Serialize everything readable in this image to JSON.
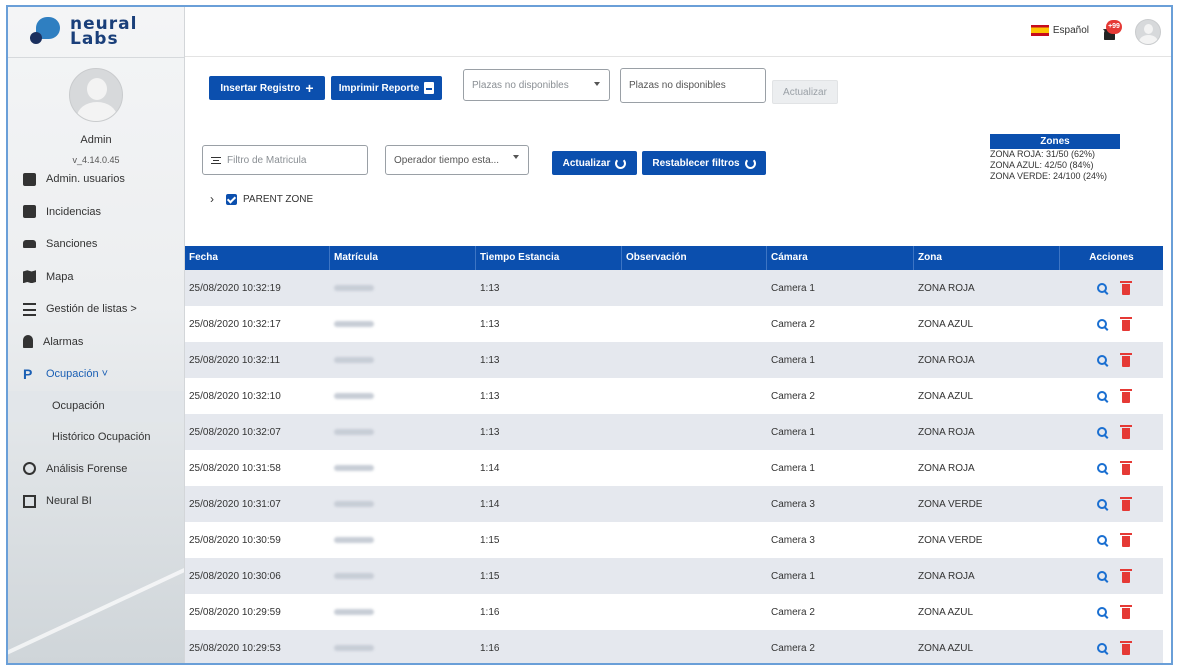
{
  "brand": {
    "line1": "neural",
    "line2": "Labs"
  },
  "user": {
    "name": "Admin",
    "version": "v_4.14.0.45"
  },
  "nav": {
    "items": [
      {
        "label": "Admin. usuarios",
        "icon": "user-badge-icon"
      },
      {
        "label": "Incidencias",
        "icon": "list-box-icon"
      },
      {
        "label": "Sanciones",
        "icon": "car-icon"
      },
      {
        "label": "Mapa",
        "icon": "map-icon"
      },
      {
        "label": "Gestión de listas >",
        "icon": "list-icon"
      },
      {
        "label": "Alarmas",
        "icon": "bell-icon"
      },
      {
        "label": "Ocupación ˅",
        "icon": "parking-icon"
      }
    ],
    "sub_items": [
      {
        "label": "Ocupación"
      },
      {
        "label": "Histórico Ocupación"
      }
    ],
    "after": [
      {
        "label": "Análisis Forense",
        "icon": "fingerprint-icon"
      },
      {
        "label": "Neural BI",
        "icon": "chart-grid-icon"
      }
    ]
  },
  "header": {
    "language": "Español",
    "notifications_badge": "+99"
  },
  "toolbar": {
    "insert_label": "Insertar Registro",
    "print_label": "Imprimir Reporte",
    "plazas_select_placeholder": "Plazas no disponibles",
    "plazas_input_placeholder": "Plazas no disponibles",
    "update_disabled_label": "Actualizar"
  },
  "filters": {
    "matricula_placeholder": "Filtro de Matricula",
    "operator_placeholder": "Operador tiempo esta...",
    "update_label": "Actualizar",
    "reset_label": "Restablecer filtros"
  },
  "zones": {
    "title": "Zones",
    "lines": [
      "ZONA ROJA: 31/50 (62%)",
      "ZONA AZUL: 42/50 (84%)",
      "ZONA VERDE: 24/100 (24%)"
    ]
  },
  "tree": {
    "label": "PARENT ZONE"
  },
  "table": {
    "columns": [
      "Fecha",
      "Matrícula",
      "Tiempo Estancia",
      "Observación",
      "Cámara",
      "Zona",
      "Acciones"
    ],
    "rows": [
      {
        "fecha": "25/08/2020 10:32:19",
        "tiempo": "1:13",
        "obs": "",
        "camara": "Camera 1",
        "zona": "ZONA ROJA"
      },
      {
        "fecha": "25/08/2020 10:32:17",
        "tiempo": "1:13",
        "obs": "",
        "camara": "Camera 2",
        "zona": "ZONA AZUL"
      },
      {
        "fecha": "25/08/2020 10:32:11",
        "tiempo": "1:13",
        "obs": "",
        "camara": "Camera 1",
        "zona": "ZONA ROJA"
      },
      {
        "fecha": "25/08/2020 10:32:10",
        "tiempo": "1:13",
        "obs": "",
        "camara": "Camera 2",
        "zona": "ZONA AZUL"
      },
      {
        "fecha": "25/08/2020 10:32:07",
        "tiempo": "1:13",
        "obs": "",
        "camara": "Camera 1",
        "zona": "ZONA ROJA"
      },
      {
        "fecha": "25/08/2020 10:31:58",
        "tiempo": "1:14",
        "obs": "",
        "camara": "Camera 1",
        "zona": "ZONA ROJA"
      },
      {
        "fecha": "25/08/2020 10:31:07",
        "tiempo": "1:14",
        "obs": "",
        "camara": "Camera 3",
        "zona": "ZONA VERDE"
      },
      {
        "fecha": "25/08/2020 10:30:59",
        "tiempo": "1:15",
        "obs": "",
        "camara": "Camera 3",
        "zona": "ZONA VERDE"
      },
      {
        "fecha": "25/08/2020 10:30:06",
        "tiempo": "1:15",
        "obs": "",
        "camara": "Camera 1",
        "zona": "ZONA ROJA"
      },
      {
        "fecha": "25/08/2020 10:29:59",
        "tiempo": "1:16",
        "obs": "",
        "camara": "Camera 2",
        "zona": "ZONA AZUL"
      },
      {
        "fecha": "25/08/2020 10:29:53",
        "tiempo": "1:16",
        "obs": "",
        "camara": "Camera 2",
        "zona": "ZONA AZUL"
      }
    ]
  },
  "colors": {
    "primary": "#0b4fae",
    "row_alt": "#e5e8ee",
    "delete": "#e53935",
    "search": "#1a6fd1"
  }
}
